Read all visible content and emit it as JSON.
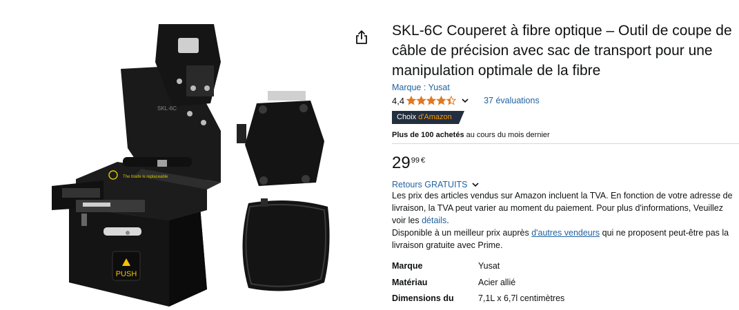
{
  "product": {
    "title_lines": [
      "SKL-6C Couperet à fibre optique – Outil de coupe de",
      "câble de précision avec sac de transport pour une",
      "manipulation optimale de la fibre"
    ],
    "brand_link": "Marque : Yusat",
    "rating_value": "4,4",
    "rating_stars": 4.4,
    "rating_count": "37 évaluations",
    "badge_prefix": "Choix",
    "badge_accent": "d'Amazon",
    "bought_bold": "Plus de 100 achetés",
    "bought_rest": " au cours du mois dernier",
    "price_whole": "29",
    "price_fraction": "99",
    "price_symbol": "€",
    "returns_label": "Retours GRATUITS",
    "tax_text": "Les prix des articles vendus sur Amazon incluent la TVA. En fonction de votre adresse de livraison, la TVA peut varier au moment du paiement. Pour plus d'informations, Veuillez voir les ",
    "tax_link": "détails",
    "tax_end": ".",
    "other_prefix": "Disponible à un meilleur prix auprès ",
    "other_link": "d'autres vendeurs",
    "other_suffix": " qui ne proposent peut-être pas la livraison gratuite avec Prime.",
    "specs": [
      {
        "key": "Marque",
        "value": "Yusat"
      },
      {
        "key": "Matériau",
        "value": "Acier allié"
      },
      {
        "key": "Dimensions du",
        "value": "7,1L x 6,7l centimètres"
      }
    ]
  },
  "image": {
    "model_label": "SKL-6C",
    "push_label": "PUSH",
    "blade_note": "The blade is replaceable"
  },
  "colors": {
    "link": "#2162a1",
    "star": "#de7921",
    "badge_bg": "#232f3e",
    "badge_accent": "#ff9900"
  }
}
